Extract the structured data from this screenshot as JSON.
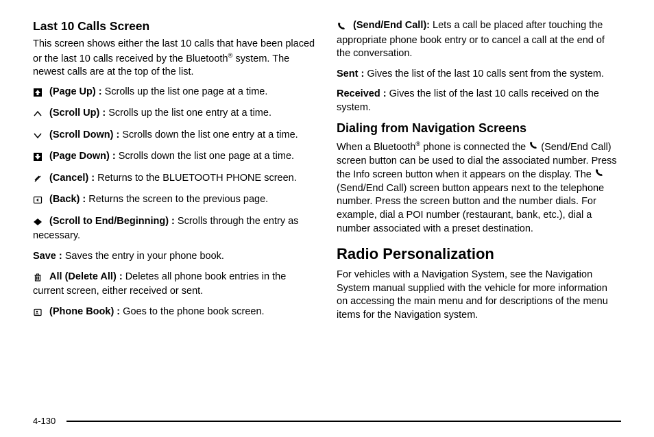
{
  "left": {
    "heading": "Last 10 Calls Screen",
    "intro_a": "This screen shows either the last 10 calls that have been placed or the last 10 calls received by the Bluetooth",
    "intro_b": " system. The newest calls are at the top of the list.",
    "reg": "®",
    "items": [
      {
        "icon": "page-up-icon",
        "label": "(Page Up) :",
        "desc": "Scrolls up the list one page at a time."
      },
      {
        "icon": "scroll-up-icon",
        "label": "(Scroll Up) :",
        "desc": "Scrolls up the list one entry at a time."
      },
      {
        "icon": "scroll-down-icon",
        "label": "(Scroll Down) :",
        "desc": "Scrolls down the list one entry at a time."
      },
      {
        "icon": "page-down-icon",
        "label": "(Page Down) :",
        "desc": "Scrolls down the list one page at a time."
      },
      {
        "icon": "cancel-icon",
        "label": "(Cancel) :",
        "desc": "Returns to the BLUETOOTH PHONE screen."
      },
      {
        "icon": "back-icon",
        "label": "(Back) :",
        "desc": "Returns the screen to the previous page."
      },
      {
        "icon": "scroll-end-icon",
        "label": "(Scroll to End/Beginning) :",
        "desc": "Scrolls through the entry as necessary."
      },
      {
        "icon": "",
        "label": "Save :",
        "desc": "Saves the entry in your phone book."
      },
      {
        "icon": "delete-all-icon",
        "label": "All (Delete All) :",
        "desc": "Deletes all phone book entries in the current screen, either received or sent."
      },
      {
        "icon": "phone-book-icon",
        "label": "(Phone Book) :",
        "desc": "Goes to the phone book screen."
      }
    ]
  },
  "right": {
    "top_items": [
      {
        "icon": "phone-icon",
        "label": "(Send/End Call):",
        "desc": "Lets a call be placed after touching the appropriate phone book entry or to cancel a call at the end of the conversation."
      },
      {
        "icon": "",
        "label": "Sent :",
        "desc": "Gives the list of the last 10 calls sent from the system."
      },
      {
        "icon": "",
        "label": "Received :",
        "desc": "Gives the list of the last 10 calls received on the system."
      }
    ],
    "dial_heading": "Dialing from Navigation Screens",
    "dial_a": "When a Bluetooth",
    "dial_reg": "®",
    "dial_b": " phone is connected the ",
    "dial_c": " (Send/End Call) screen button can be used to dial the associated number. Press the Info screen button when it appears on the display. The ",
    "dial_d": " (Send/End Call) screen button appears next to the telephone number. Press the screen button and the number dials. For example, dial a POI number (restaurant, bank, etc.), dial a number associated with a preset destination.",
    "radio_heading": "Radio Personalization",
    "radio_para": "For vehicles with a Navigation System, see the Navigation System manual supplied with the vehicle for more information on accessing the main menu and for descriptions of the menu items for the Navigation system."
  },
  "page_number": "4-130"
}
